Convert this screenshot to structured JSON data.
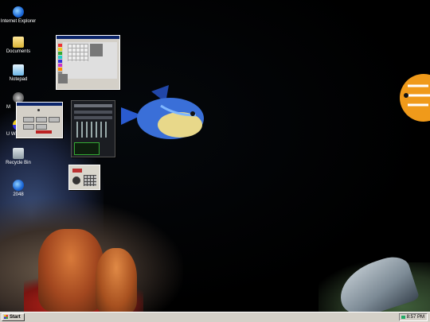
{
  "desktop": {
    "icons": [
      {
        "label": "Internet Explorer",
        "icon": "internet-explorer-icon"
      },
      {
        "label": "Documents",
        "icon": "folder-icon"
      },
      {
        "label": "Notepad",
        "icon": "notepad-icon"
      },
      {
        "label": "M",
        "icon": "media-player-icon"
      },
      {
        "label": "U Windows",
        "icon": "windows-update-icon"
      },
      {
        "label": "Recycle Bin",
        "icon": "recycle-bin-icon"
      },
      {
        "label": "2048",
        "icon": "globe-icon"
      }
    ]
  },
  "taskbar": {
    "start_label": "Start",
    "clock": "8:57 PM"
  },
  "colors": {
    "taskbar": "#d4d0c8",
    "titlebar": "#0a246a",
    "desktop_bg": "#000000"
  }
}
